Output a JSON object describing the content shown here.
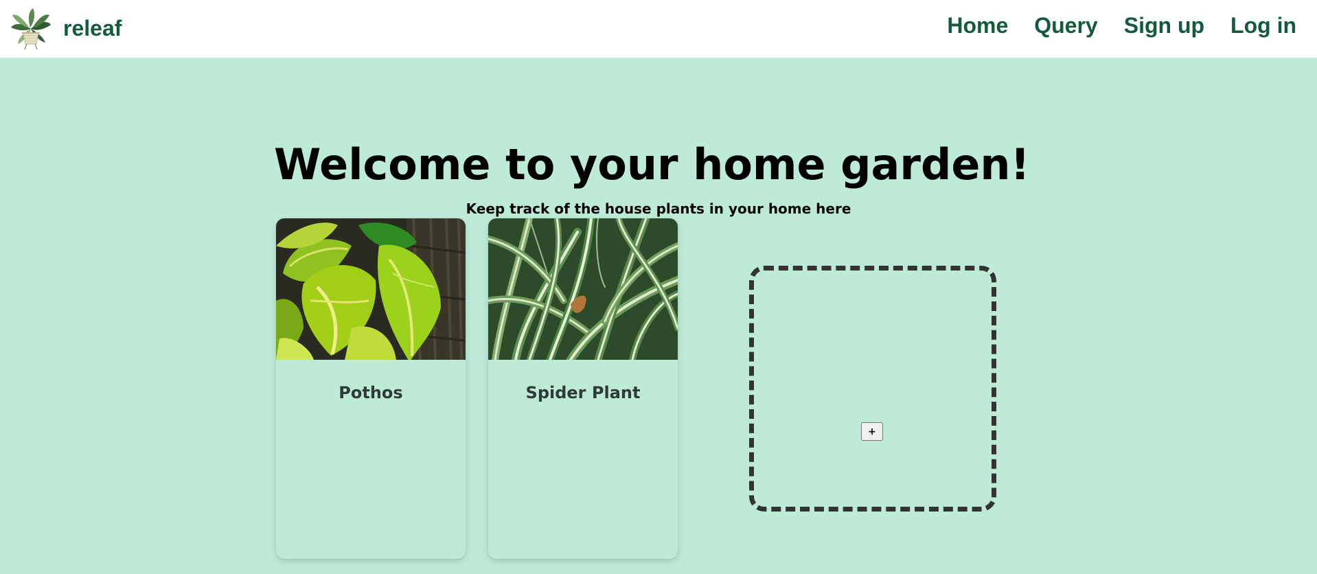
{
  "header": {
    "brand_name": "releaf",
    "logo_icon": "potted-plant-icon",
    "nav": [
      {
        "label": "Home"
      },
      {
        "label": "Query"
      },
      {
        "label": "Sign up"
      },
      {
        "label": "Log in"
      }
    ],
    "colors": {
      "brand": "#145a3c",
      "background": "#ffffff"
    }
  },
  "main": {
    "title": "Welcome to your home garden!",
    "subtitle": "Keep track of the house plants in your home here",
    "background": "#bdebd8",
    "plants": [
      {
        "name": "Pothos",
        "image": "pothos-leaves"
      },
      {
        "name": "Spider Plant",
        "image": "spider-plant-leaves"
      }
    ],
    "add_button_label": "+"
  }
}
